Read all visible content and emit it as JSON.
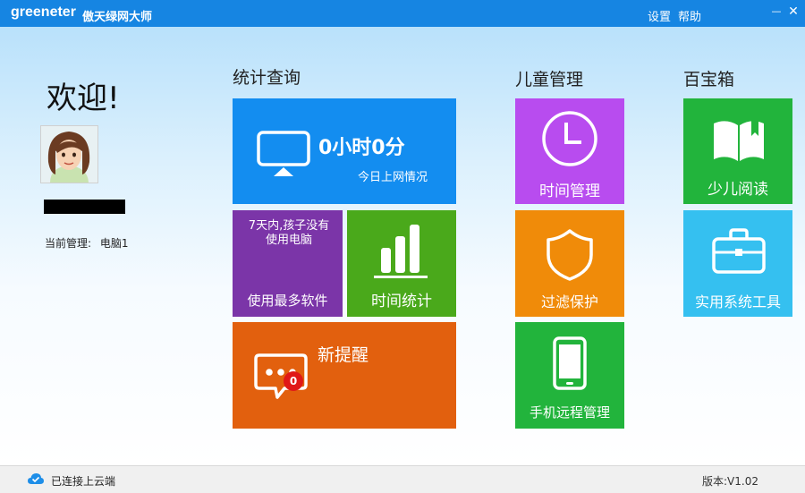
{
  "titlebar": {
    "logo": "greeneter",
    "app_name": "傲天绿网大师",
    "settings_label": "设置",
    "help_label": "帮助",
    "minimize_glyph": "—",
    "close_glyph": "✕"
  },
  "left_panel": {
    "welcome": "欢迎!",
    "current_manage_label": "当前管理:",
    "current_device": "电脑1"
  },
  "sections": {
    "stats": "统计查询",
    "child": "儿童管理",
    "toolbox": "百宝箱"
  },
  "tiles": {
    "online_time_value": "0小时0分",
    "online_time_label": "今日上网情况",
    "most_used_note": "7天内,孩子没有使用电脑",
    "most_used_label": "使用最多软件",
    "time_stats_label": "时间统计",
    "reminder_label": "新提醒",
    "reminder_count": "0",
    "time_manage_label": "时间管理",
    "filter_label": "过滤保护",
    "mobile_label": "手机远程管理",
    "reading_label": "少儿阅读",
    "tools_label": "实用系统工具"
  },
  "statusbar": {
    "cloud_status": "已连接上云端",
    "version": "版本:V1.02"
  },
  "colors": {
    "titlebar": "#1685e2",
    "blue_tile": "#138df0",
    "purple_tile": "#7b35a8",
    "green_tile": "#4aa91b",
    "orange_tile": "#e2600e",
    "magenta_tile": "#b84cef",
    "amber_tile": "#f08b09",
    "bright_green_tile": "#22b43c",
    "sky_tile": "#35c0f0"
  }
}
